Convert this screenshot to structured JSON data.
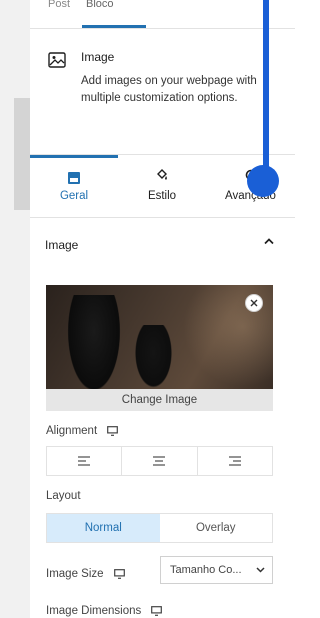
{
  "top_tabs": [
    "Post",
    "Bloco"
  ],
  "block": {
    "name": "Image",
    "description": "Add images on your webpage with multiple customization options."
  },
  "settings_tabs": [
    {
      "label": "Geral",
      "icon": "layout-icon",
      "active": true
    },
    {
      "label": "Estilo",
      "icon": "paint-bucket-icon",
      "active": false
    },
    {
      "label": "Avançado",
      "icon": "gear-icon",
      "active": false
    }
  ],
  "section": {
    "title": "Image",
    "expanded": true
  },
  "image": {
    "change_label": "Change Image"
  },
  "alignment": {
    "label": "Alignment"
  },
  "layout": {
    "label": "Layout",
    "options": [
      "Normal",
      "Overlay"
    ],
    "selected": "Normal"
  },
  "image_size": {
    "label": "Image Size",
    "value": "Tamanho Co..."
  },
  "image_dimensions": {
    "label": "Image Dimensions"
  },
  "colors": {
    "accent": "#2271b1",
    "overlay_annotation": "#1a5fd6",
    "active_bg": "#d7ebfb"
  }
}
